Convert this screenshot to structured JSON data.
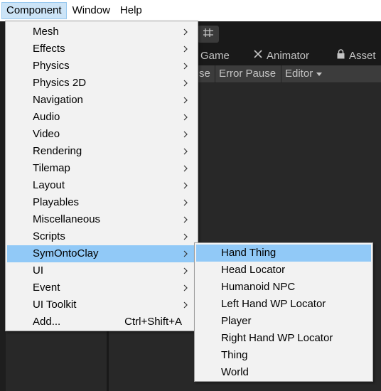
{
  "menubar": {
    "items": [
      {
        "label": "Component",
        "active": true
      },
      {
        "label": "Window",
        "active": false
      },
      {
        "label": "Help",
        "active": false
      }
    ]
  },
  "editor": {
    "tabs": {
      "game": "Game",
      "animator": "Animator",
      "asset": "Asset"
    },
    "toolbar": {
      "partial": "se",
      "error_pause": "Error Pause",
      "editor": "Editor"
    }
  },
  "component_menu": {
    "items": [
      {
        "label": "Mesh",
        "submenu": true
      },
      {
        "label": "Effects",
        "submenu": true
      },
      {
        "label": "Physics",
        "submenu": true
      },
      {
        "label": "Physics 2D",
        "submenu": true
      },
      {
        "label": "Navigation",
        "submenu": true
      },
      {
        "label": "Audio",
        "submenu": true
      },
      {
        "label": "Video",
        "submenu": true
      },
      {
        "label": "Rendering",
        "submenu": true
      },
      {
        "label": "Tilemap",
        "submenu": true
      },
      {
        "label": "Layout",
        "submenu": true
      },
      {
        "label": "Playables",
        "submenu": true
      },
      {
        "label": "Miscellaneous",
        "submenu": true
      },
      {
        "label": "Scripts",
        "submenu": true
      },
      {
        "label": "SymOntoClay",
        "submenu": true,
        "highlighted": true
      },
      {
        "label": "UI",
        "submenu": true
      },
      {
        "label": "Event",
        "submenu": true
      },
      {
        "label": "UI Toolkit",
        "submenu": true
      },
      {
        "label": "Add...",
        "shortcut": "Ctrl+Shift+A"
      }
    ]
  },
  "symontoclay_menu": {
    "items": [
      {
        "label": "Hand Thing",
        "highlighted": true
      },
      {
        "label": "Head Locator"
      },
      {
        "label": "Humanoid NPC"
      },
      {
        "label": "Left Hand WP Locator"
      },
      {
        "label": "Player"
      },
      {
        "label": "Right Hand WP Locator"
      },
      {
        "label": "Thing"
      },
      {
        "label": "World"
      }
    ]
  },
  "colors": {
    "menu_bg": "#f2f2f2",
    "highlight": "#91c9f7",
    "menubar_active": "#cce4f7",
    "editor_bg": "#282828"
  }
}
